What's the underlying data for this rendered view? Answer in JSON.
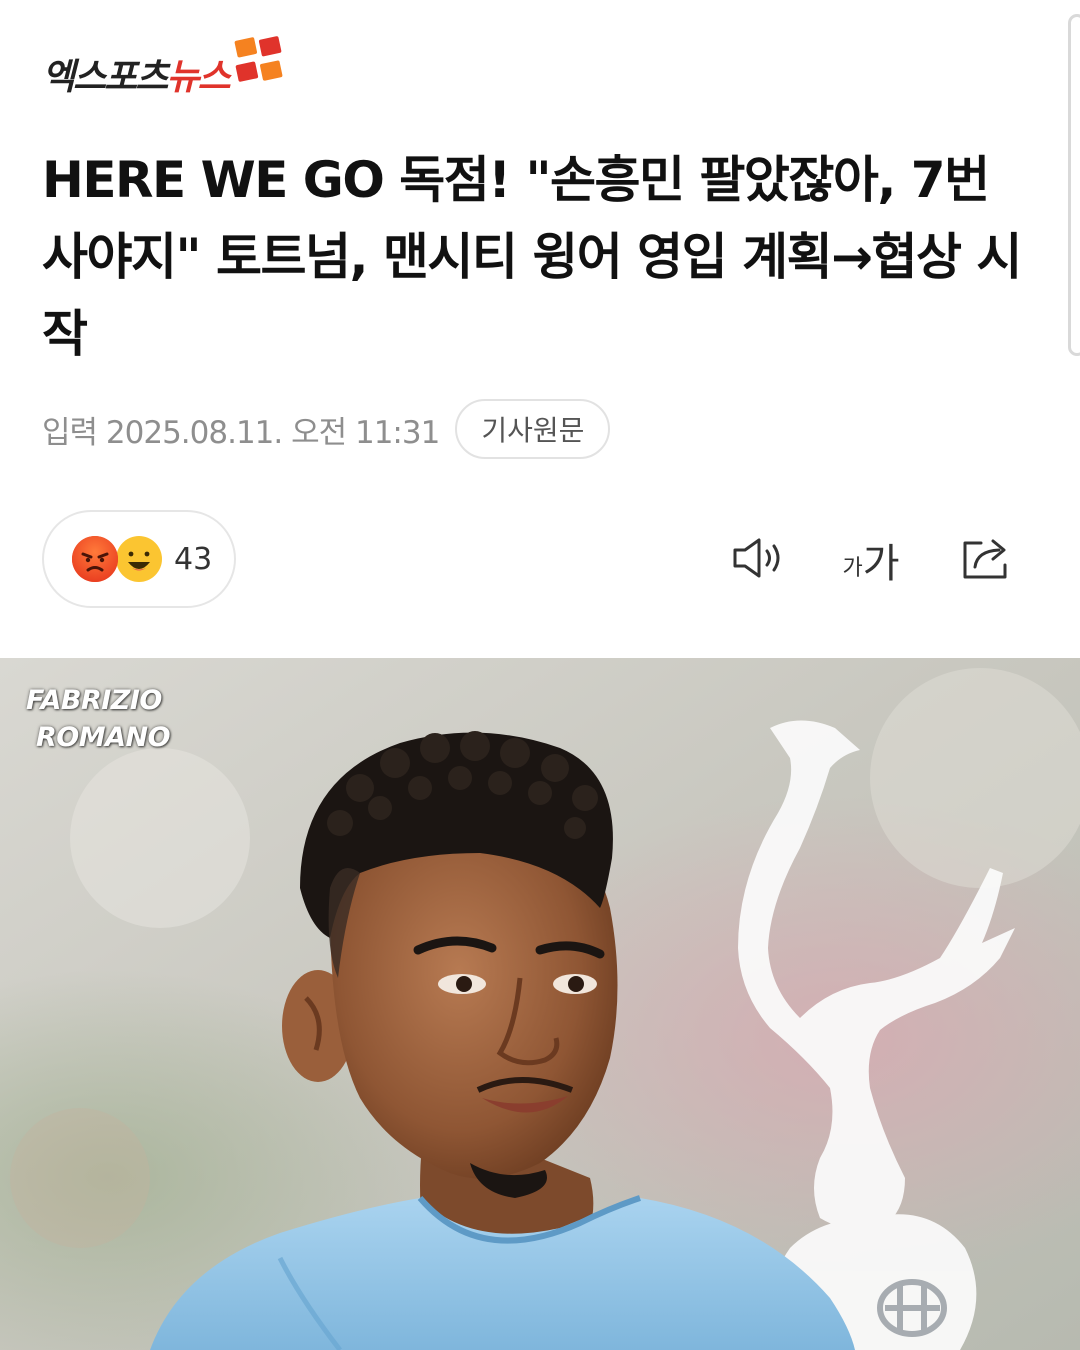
{
  "header": {
    "logo_dark": "엑스포츠",
    "logo_red": "뉴스"
  },
  "article": {
    "title": "HERE WE GO 독점! \"손흥민 팔았잖아, 7번 사야지\" 토트넘, 맨시티 윙어 영입 계획→협상 시작",
    "date": "입력 2025.08.11. 오전 11:31",
    "source_button": "기사원문"
  },
  "reactions": {
    "count": "43",
    "icons": [
      "angry-face",
      "smiling-face"
    ]
  },
  "toolbar": {
    "speaker_icon": "speaker-icon",
    "font_small": "가",
    "font_large": "가",
    "share_icon": "share-icon"
  },
  "hero": {
    "watermark_line1": "FABRIZIO",
    "watermark_line2": "ROMANO"
  },
  "colors": {
    "brand_red": "#e0332b",
    "brand_orange": "#f58220",
    "meta_gray": "#8e8e8e",
    "jersey_blue": "#8ec3e6"
  }
}
